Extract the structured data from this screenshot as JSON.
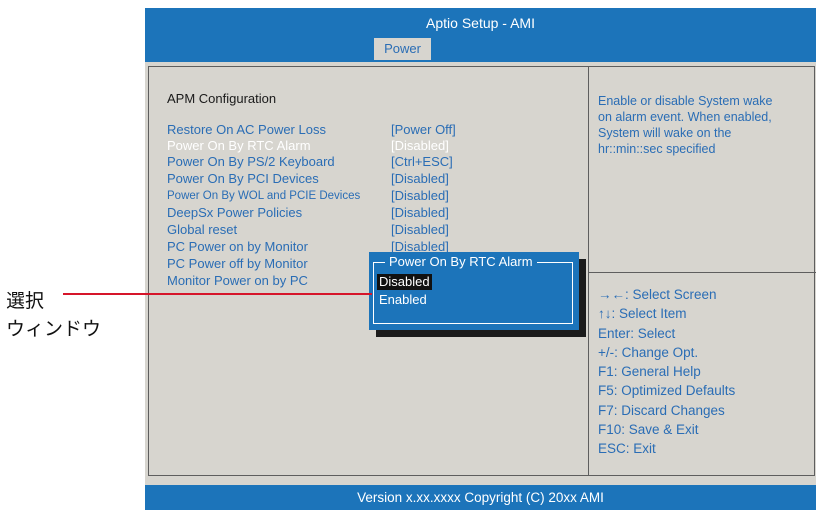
{
  "header": {
    "title": "Aptio Setup - AMI",
    "active_tab": "Power"
  },
  "section_title": "APM  Configuration",
  "settings": [
    {
      "label": "Restore On AC Power Loss",
      "value": "[Power Off]",
      "highlighted": false
    },
    {
      "label": "Power On By RTC Alarm",
      "value": "[Disabled]",
      "highlighted": true
    },
    {
      "label": "Power On By PS/2 Keyboard",
      "value": "[Ctrl+ESC]",
      "highlighted": false
    },
    {
      "label": "Power On By PCI Devices",
      "value": "[Disabled]",
      "highlighted": false
    },
    {
      "label": "Power On By WOL and PCIE Devices",
      "value": "[Disabled]",
      "highlighted": false
    },
    {
      "label": "DeepSx Power Policies",
      "value": "[Disabled]",
      "highlighted": false
    },
    {
      "label": "Global reset",
      "value": "[Disabled]",
      "highlighted": false
    },
    {
      "label": "PC Power on by Monitor",
      "value": "[Disabled]",
      "highlighted": false
    },
    {
      "label": "PC Power off by Monitor",
      "value": "",
      "highlighted": false
    },
    {
      "label": "Monitor Power on by PC",
      "value": "",
      "highlighted": false
    }
  ],
  "help_lines": [
    "Enable or disable System wake",
    "on alarm event. When enabled,",
    "System will wake on the",
    "hr::min::sec specified"
  ],
  "key_help": [
    "→←: Select Screen",
    "↑↓: Select Item",
    "Enter: Select",
    "+/-: Change Opt.",
    "F1: General Help",
    "F5: Optimized Defaults",
    "F7: Discard Changes",
    "F10: Save & Exit",
    "ESC: Exit"
  ],
  "popup": {
    "title": "Power On By RTC Alarm",
    "options": [
      "Disabled",
      "Enabled"
    ],
    "selected": "Disabled"
  },
  "footer": "Version x.xx.xxxx Copyright (C) 20xx AMI",
  "callout": {
    "line1": "選択",
    "line2": "ウィンドウ"
  },
  "colors": {
    "accent": "#1c74ba",
    "text_blue": "#2a6db5",
    "panel_bg": "#d7d5cf",
    "callout_line": "#d6152a"
  }
}
